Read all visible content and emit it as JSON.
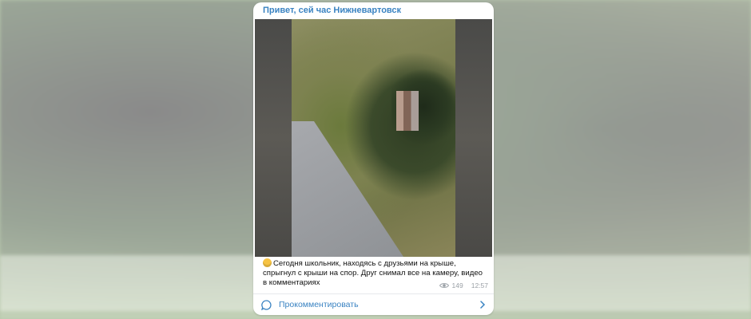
{
  "post": {
    "channel_name": "Привет, сей час Нижневартовск",
    "caption_emoji": "face-screaming-emoji",
    "caption_text": "Сегодня школьник, находясь с друзьями на крыше, спрыгнул с крыши на спор. Друг снимал все на камеру, видео в комментариях",
    "views": "149",
    "time": "12:57",
    "comment_button_label": "Прокомментировать",
    "icons": [
      "eye-icon",
      "comment-bubble-icon",
      "chevron-right-icon"
    ]
  },
  "colors": {
    "accent": "#3a83c2",
    "meta_text": "#9aa0a6",
    "background": "#b9c9ad"
  }
}
